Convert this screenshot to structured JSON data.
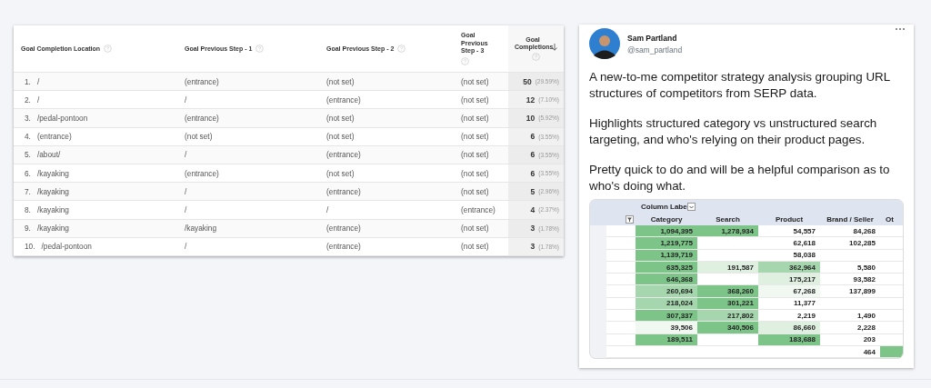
{
  "goals_table": {
    "columns": [
      {
        "label": "Goal Completion Location",
        "kind": "text"
      },
      {
        "label": "Goal Previous Step - 1",
        "kind": "text"
      },
      {
        "label": "Goal Previous Step - 2",
        "kind": "text"
      },
      {
        "label": "Goal Previous Step - 3",
        "kind": "narrow"
      },
      {
        "label": "Goal Completions",
        "kind": "metric"
      }
    ],
    "rows": [
      {
        "index": "1.",
        "cells": [
          "/",
          "(entrance)",
          "(not set)",
          "(not set)"
        ],
        "value": "50",
        "share": "(29.59%)"
      },
      {
        "index": "2.",
        "cells": [
          "/",
          "/",
          "(entrance)",
          "(not set)"
        ],
        "value": "12",
        "share": "(7.10%)"
      },
      {
        "index": "3.",
        "cells": [
          "/pedal-pontoon",
          "(entrance)",
          "(not set)",
          "(not set)"
        ],
        "value": "10",
        "share": "(5.92%)"
      },
      {
        "index": "4.",
        "cells": [
          "(entrance)",
          "(not set)",
          "(not set)",
          "(not set)"
        ],
        "value": "6",
        "share": "(3.55%)"
      },
      {
        "index": "5.",
        "cells": [
          "/about/",
          "/",
          "(entrance)",
          "(not set)"
        ],
        "value": "6",
        "share": "(3.55%)"
      },
      {
        "index": "6.",
        "cells": [
          "/kayaking",
          "(entrance)",
          "(not set)",
          "(not set)"
        ],
        "value": "6",
        "share": "(3.55%)"
      },
      {
        "index": "7.",
        "cells": [
          "/kayaking",
          "/",
          "(entrance)",
          "(not set)"
        ],
        "value": "5",
        "share": "(2.96%)"
      },
      {
        "index": "8.",
        "cells": [
          "/kayaking",
          "/",
          "/",
          "(entrance)"
        ],
        "value": "4",
        "share": "(2.37%)"
      },
      {
        "index": "9.",
        "cells": [
          "/kayaking",
          "/kayaking",
          "(entrance)",
          "(not set)"
        ],
        "value": "3",
        "share": "(1.78%)"
      },
      {
        "index": "10.",
        "cells": [
          "/pedal-pontoon",
          "/",
          "(entrance)",
          "(not set)"
        ],
        "value": "3",
        "share": "(1.78%)"
      }
    ]
  },
  "tweet": {
    "author": {
      "name": "Sam Partland",
      "handle": "@sam_partland"
    },
    "paragraphs": [
      "A new-to-me competitor strategy analysis grouping URL structures of competitors from SERP data.",
      "Highlights structured category vs unstructured search targeting, and who's relying on their product pages.",
      "Pretty quick to do and will be a helpful comparison as to who's doing what."
    ],
    "pivot": {
      "header_label": "Column Labe",
      "columns": [
        "Category",
        "Search",
        "Product",
        "Brand / Seller",
        "Ot"
      ],
      "rows": [
        [
          {
            "text": "1,094,395",
            "color": "#7dc488"
          },
          {
            "text": "1,278,934",
            "color": "#7dc488"
          },
          {
            "text": "54,557",
            "color": "#ffffff"
          },
          {
            "text": "84,268",
            "color": "#ffffff"
          },
          {
            "color": "#ffffff"
          }
        ],
        [
          {
            "text": "1,219,775",
            "color": "#7dc488"
          },
          {
            "color": "#ffffff"
          },
          {
            "text": "62,618",
            "color": "#ffffff"
          },
          {
            "text": "102,285",
            "color": "#ffffff"
          },
          {
            "color": "#ffffff"
          }
        ],
        [
          {
            "text": "1,139,719",
            "color": "#7dc488"
          },
          {
            "color": "#ffffff"
          },
          {
            "text": "58,038",
            "color": "#ffffff"
          },
          {
            "color": "#ffffff"
          },
          {
            "color": "#ffffff"
          }
        ],
        [
          {
            "text": "635,325",
            "color": "#7dc488"
          },
          {
            "text": "191,587",
            "color": "#dff0e1"
          },
          {
            "text": "362,964",
            "color": "#a6d6ad"
          },
          {
            "text": "5,580",
            "color": "#ffffff"
          },
          {
            "color": "#ffffff"
          }
        ],
        [
          {
            "text": "646,368",
            "color": "#7dc488"
          },
          {
            "color": "#ffffff"
          },
          {
            "text": "175,217",
            "color": "#dff0e1"
          },
          {
            "text": "93,582",
            "color": "#ffffff"
          },
          {
            "color": "#ffffff"
          }
        ],
        [
          {
            "text": "260,694",
            "color": "#a6d6ad"
          },
          {
            "text": "368,260",
            "color": "#7dc488"
          },
          {
            "text": "67,268",
            "color": "#f1f8f2"
          },
          {
            "text": "137,899",
            "color": "#ffffff"
          },
          {
            "color": "#ffffff"
          }
        ],
        [
          {
            "text": "218,024",
            "color": "#a6d6ad"
          },
          {
            "text": "301,221",
            "color": "#7dc488"
          },
          {
            "text": "11,377",
            "color": "#ffffff"
          },
          {
            "color": "#ffffff"
          },
          {
            "color": "#ffffff"
          }
        ],
        [
          {
            "text": "307,337",
            "color": "#7dc488"
          },
          {
            "text": "217,802",
            "color": "#a6d6ad"
          },
          {
            "text": "2,219",
            "color": "#ffffff"
          },
          {
            "text": "1,490",
            "color": "#ffffff"
          },
          {
            "color": "#ffffff"
          }
        ],
        [
          {
            "text": "39,506",
            "color": "#f1f8f2"
          },
          {
            "text": "340,506",
            "color": "#7dc488"
          },
          {
            "text": "86,660",
            "color": "#dff0e1"
          },
          {
            "text": "2,228",
            "color": "#ffffff"
          },
          {
            "color": "#ffffff"
          }
        ],
        [
          {
            "text": "189,511",
            "color": "#7dc488"
          },
          {
            "color": "#ffffff"
          },
          {
            "text": "183,688",
            "color": "#7dc488"
          },
          {
            "text": "203",
            "color": "#ffffff"
          },
          {
            "color": "#ffffff"
          }
        ],
        [
          {
            "color": "#ffffff"
          },
          {
            "color": "#ffffff"
          },
          {
            "color": "#ffffff"
          },
          {
            "text": "464",
            "color": "#ffffff"
          },
          {
            "color": "#7dc488"
          }
        ]
      ]
    }
  }
}
